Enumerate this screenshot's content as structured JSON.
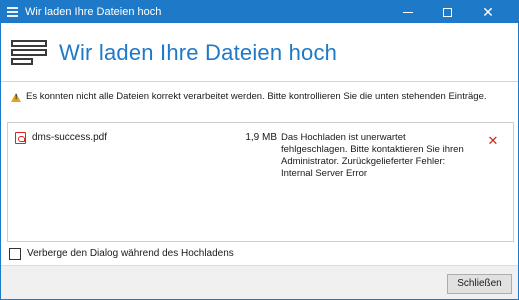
{
  "window": {
    "title": "Wir laden Ihre Dateien hoch",
    "accent_color": "#1e79c8",
    "controls": {
      "minimize_icon": "minimize-icon",
      "maximize_icon": "maximize-icon",
      "close_symbol": "✕"
    }
  },
  "header": {
    "icon": "upload-list-icon",
    "title": "Wir laden Ihre Dateien hoch"
  },
  "warning": {
    "icon": "warning-icon",
    "color": "#e3a21a",
    "text": "Es konnten nicht alle Dateien korrekt verarbeitet werden. Bitte kontrollieren Sie die unten stehenden Einträge."
  },
  "files": [
    {
      "icon": "pdf-file-icon",
      "name": "dms-success.pdf",
      "size": "1,9 MB",
      "error": "Das Hochladen ist unerwartet fehlgeschlagen. Bitte kontaktieren Sie ihren Administrator. Zurückgelieferter Fehler: Internal Server Error",
      "remove_symbol": "✕",
      "error_color": "#d0281c"
    }
  ],
  "options": {
    "hide_dialog_label": "Verberge den Dialog während des Hochladens",
    "hide_dialog_checked": false
  },
  "footer": {
    "close_label": "Schließen"
  }
}
